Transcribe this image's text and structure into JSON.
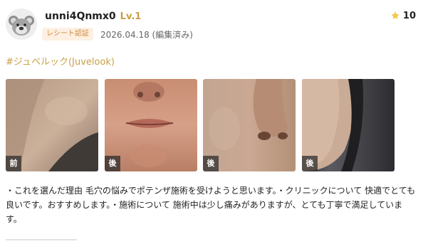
{
  "review": {
    "user": {
      "avatar_icon": "koala-avatar-icon",
      "name": "unni4Qnmx0",
      "level": "Lv.1"
    },
    "badge": "レシート認証",
    "date": "2026.04.18 (編集済み)",
    "rating": {
      "icon": "star-icon",
      "value": "10",
      "star_color": "#f2c94c"
    },
    "hashtag": "#ジュベルック(Juvelook)",
    "photos": [
      {
        "label": "前",
        "subject": "cheek-jawline-closeup"
      },
      {
        "label": "後",
        "subject": "lips-chin-closeup"
      },
      {
        "label": "後",
        "subject": "nose-cheek-closeup"
      },
      {
        "label": "後",
        "subject": "cheek-profile-in-car"
      }
    ],
    "text": "・これを選んだ理由 毛穴の悩みでポテンザ施術を受けようと思います。・クリニックについて 快適でとても良いです。おすすめします。・施術について 施術中は少し痛みがありますが、とても丁寧で満足しています。"
  },
  "colors": {
    "accent_gold": "#c9a046",
    "badge_bg": "#fdf0e2",
    "badge_text": "#cf8a3e"
  }
}
